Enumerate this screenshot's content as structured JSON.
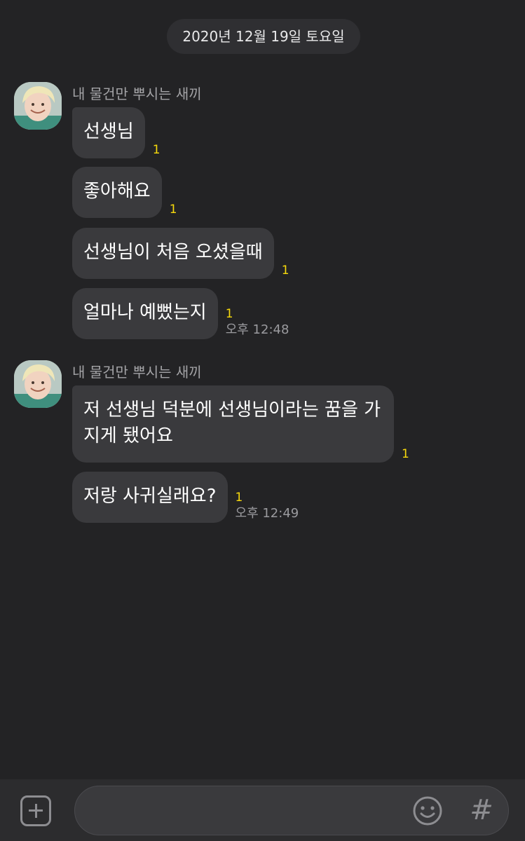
{
  "date_divider": "2020년 12월 19일 토요일",
  "groups": [
    {
      "sender": "내 물건만 뿌시는 새끼",
      "messages": [
        {
          "text": "선생님",
          "unread": "1",
          "time": ""
        },
        {
          "text": "좋아해요",
          "unread": "1",
          "time": ""
        },
        {
          "text": "선생님이 처음 오셨을때",
          "unread": "1",
          "time": ""
        },
        {
          "text": "얼마나 예뻤는지",
          "unread": "1",
          "time": "오후 12:48"
        }
      ]
    },
    {
      "sender": "내 물건만 뿌시는 새끼",
      "messages": [
        {
          "text": "저 선생님 덕분에 선생님이라는 꿈을 가지게 됐어요",
          "unread": "1",
          "time": ""
        },
        {
          "text": "저랑 사귀실래요?",
          "unread": "1",
          "time": "오후 12:49"
        }
      ]
    }
  ],
  "input": {
    "value": "",
    "placeholder": ""
  },
  "icons": {
    "attach": "plus-square-icon",
    "emoji": "smiley-icon",
    "hashtag": "hashtag-icon"
  },
  "colors": {
    "background": "#232325",
    "bubble": "#3a3a3d",
    "unread": "#f7d90c",
    "timestamp": "#9a9a9e"
  }
}
